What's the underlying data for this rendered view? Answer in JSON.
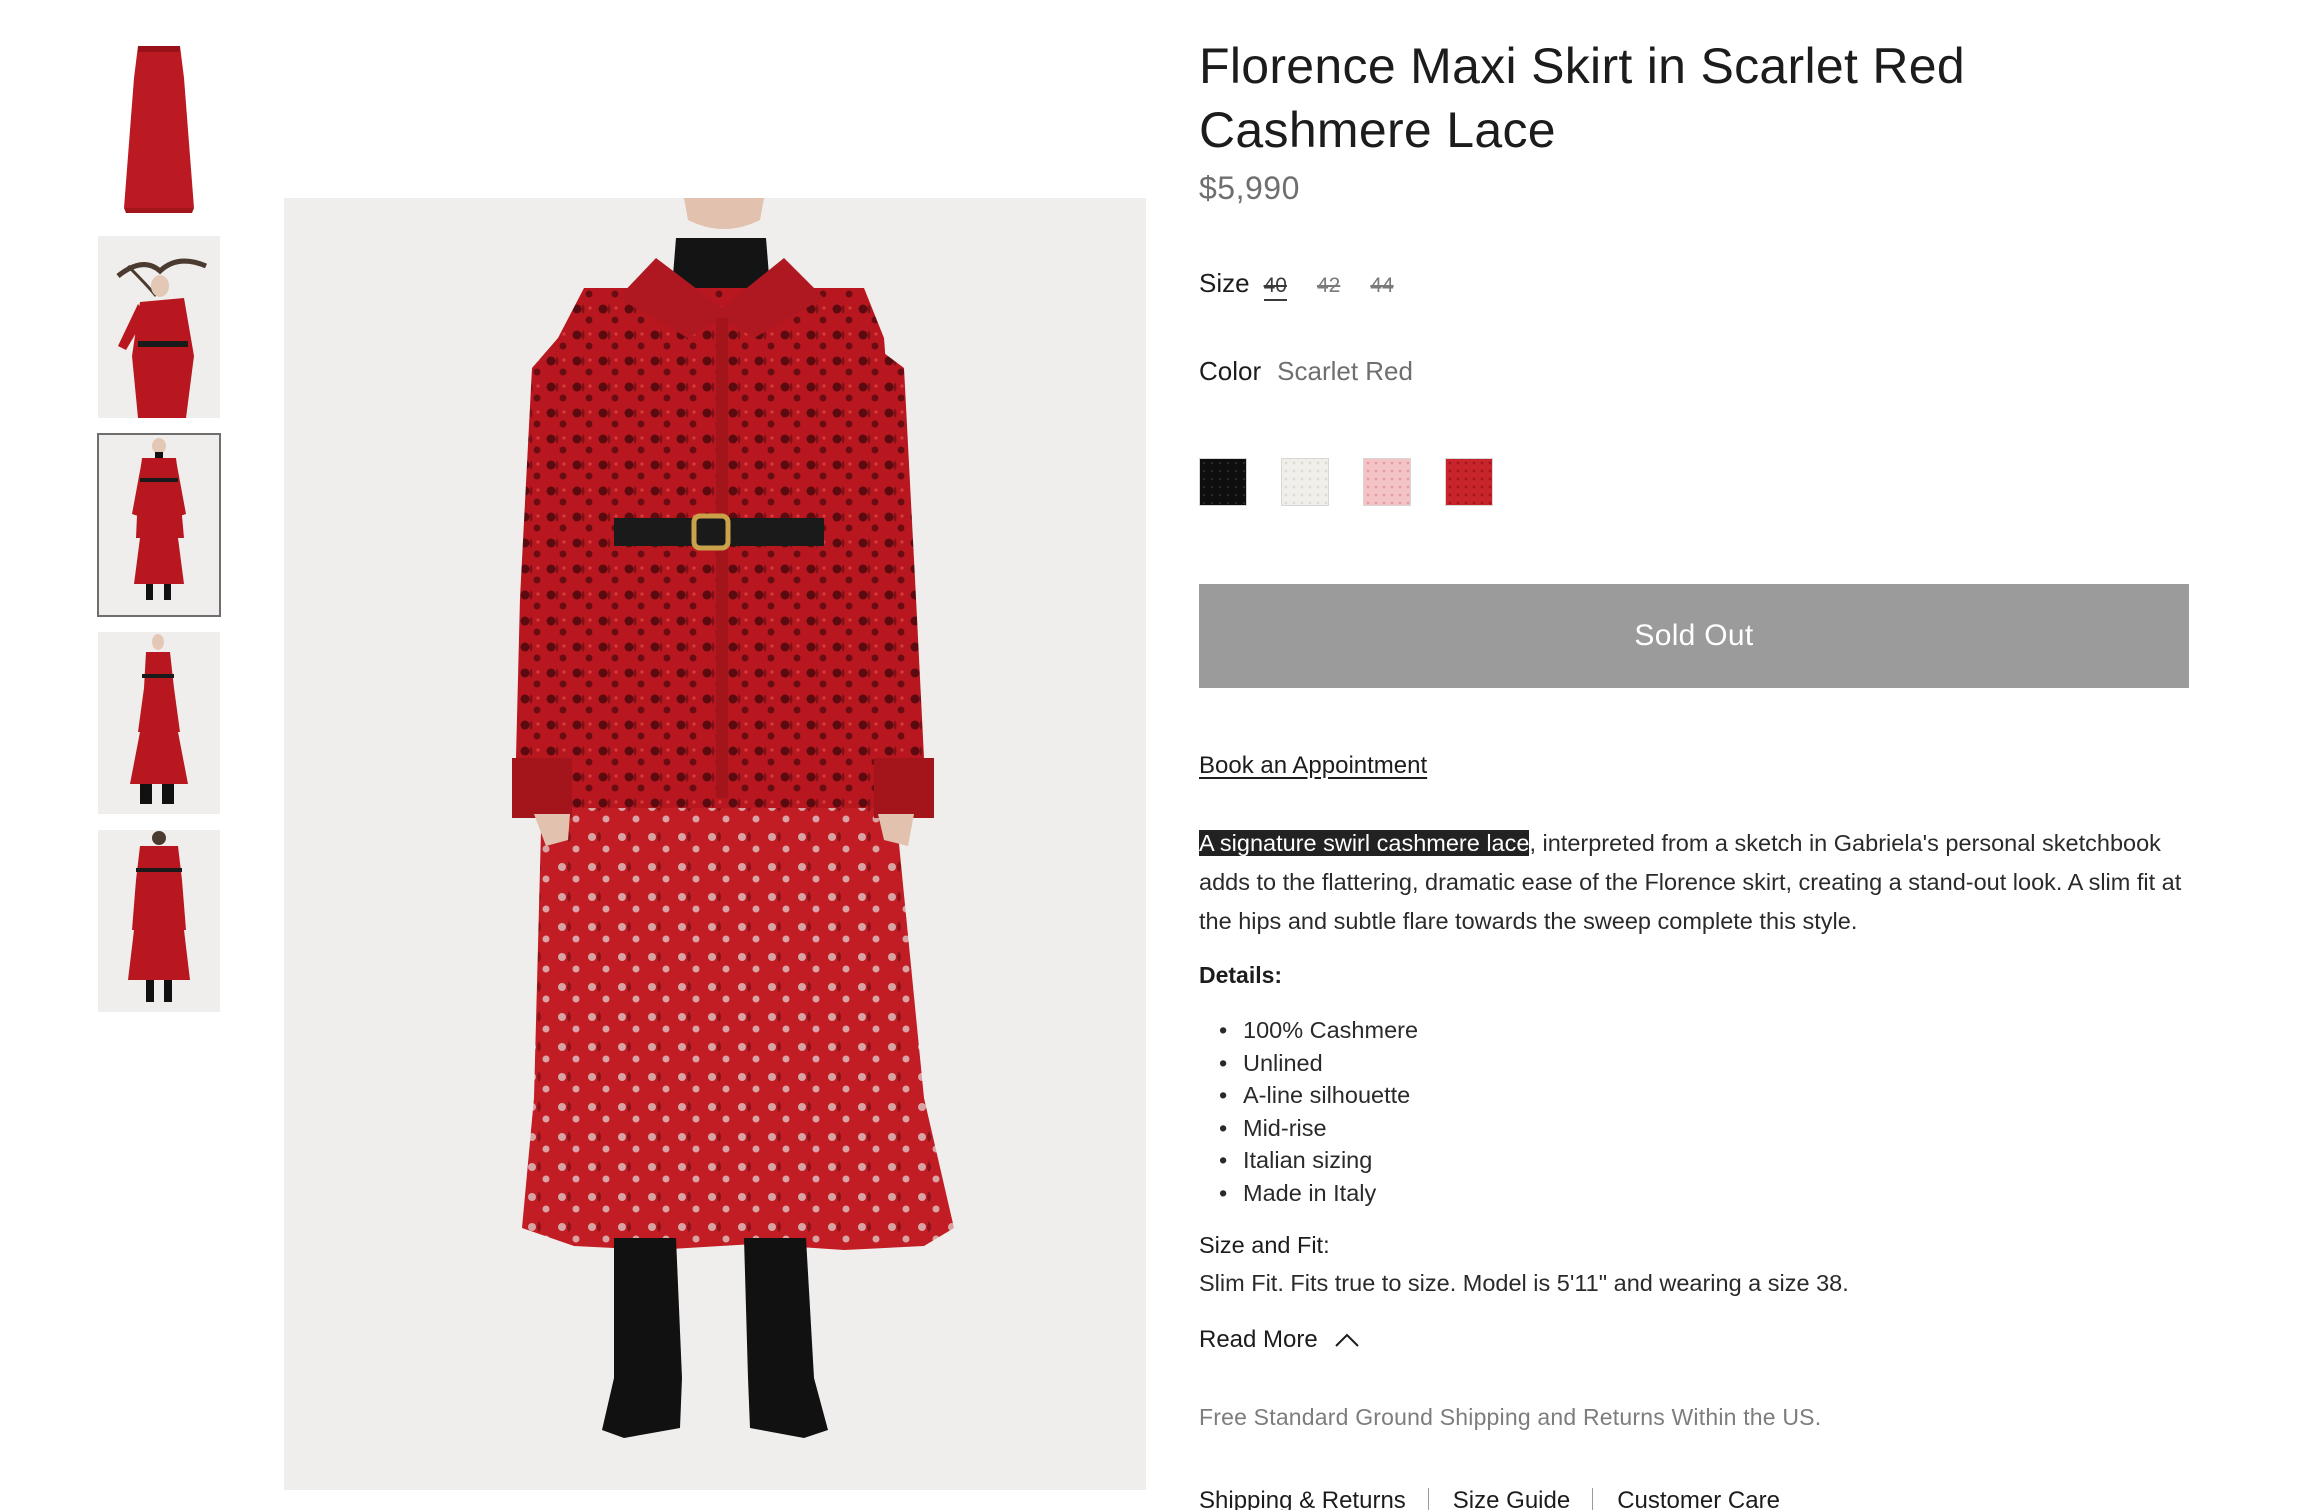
{
  "product": {
    "title_line1": "Florence Maxi Skirt in Scarlet Red",
    "title_line2": "Cashmere Lace",
    "price": "$5,990"
  },
  "size": {
    "label": "Size",
    "options": [
      "40",
      "42",
      "44"
    ]
  },
  "color": {
    "label": "Color",
    "selected": "Scarlet Red",
    "swatches": [
      {
        "name": "black",
        "hex": "#0e0e0e"
      },
      {
        "name": "ivory",
        "hex": "#f1efea"
      },
      {
        "name": "pink",
        "hex": "#f4c3c6"
      },
      {
        "name": "scarlet-red",
        "hex": "#c8242b"
      }
    ]
  },
  "actions": {
    "sold_out": "Sold Out",
    "book_appointment": "Book an Appointment"
  },
  "description": {
    "highlight": "A signature swirl cashmere lace",
    "rest": ", interpreted from a sketch in Gabriela's personal sketchbook adds to the flattering, dramatic ease of the Florence skirt, creating a stand-out look. A slim fit at the hips and subtle flare towards the sweep complete this style."
  },
  "details": {
    "heading": "Details:",
    "items": [
      "100% Cashmere",
      "Unlined",
      "A-line silhouette",
      "Mid-rise",
      "Italian sizing",
      "Made in Italy"
    ]
  },
  "size_fit": {
    "heading": "Size and Fit:",
    "text": "Slim Fit. Fits true to size. Model is 5'11\" and wearing a size 38."
  },
  "read_more": "Read More",
  "shipping_note": "Free Standard Ground Shipping and Returns Within the US.",
  "footer_links": [
    "Shipping & Returns",
    "Size Guide",
    "Customer Care"
  ],
  "colors": {
    "garment_red": "#b8171f",
    "button_gray": "#9b9b9b",
    "image_bg": "#efeeec"
  },
  "icons": {
    "read_more": "chevron-up-icon"
  }
}
